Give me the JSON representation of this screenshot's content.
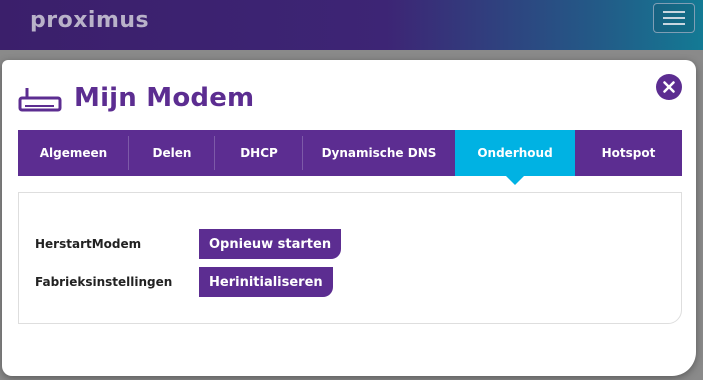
{
  "header": {
    "logo_text": "proximus",
    "menu_icon": "hamburger-menu-icon"
  },
  "modal": {
    "title": "Mijn Modem",
    "title_icon": "router-icon",
    "close_icon": "close-icon"
  },
  "tabs": [
    {
      "label": "Algemeen",
      "active": false
    },
    {
      "label": "Delen",
      "active": false
    },
    {
      "label": "DHCP",
      "active": false
    },
    {
      "label": "Dynamische DNS",
      "active": false
    },
    {
      "label": "Onderhoud",
      "active": true
    },
    {
      "label": "Hotspot",
      "active": false
    }
  ],
  "maintenance": {
    "rows": [
      {
        "label": "HerstartModem",
        "button": "Opnieuw starten"
      },
      {
        "label": "Fabrieksinstellingen",
        "button": "Herinitialiseren"
      }
    ]
  },
  "colors": {
    "brand_purple": "#5c2d91",
    "active_tab": "#00b2e3"
  }
}
